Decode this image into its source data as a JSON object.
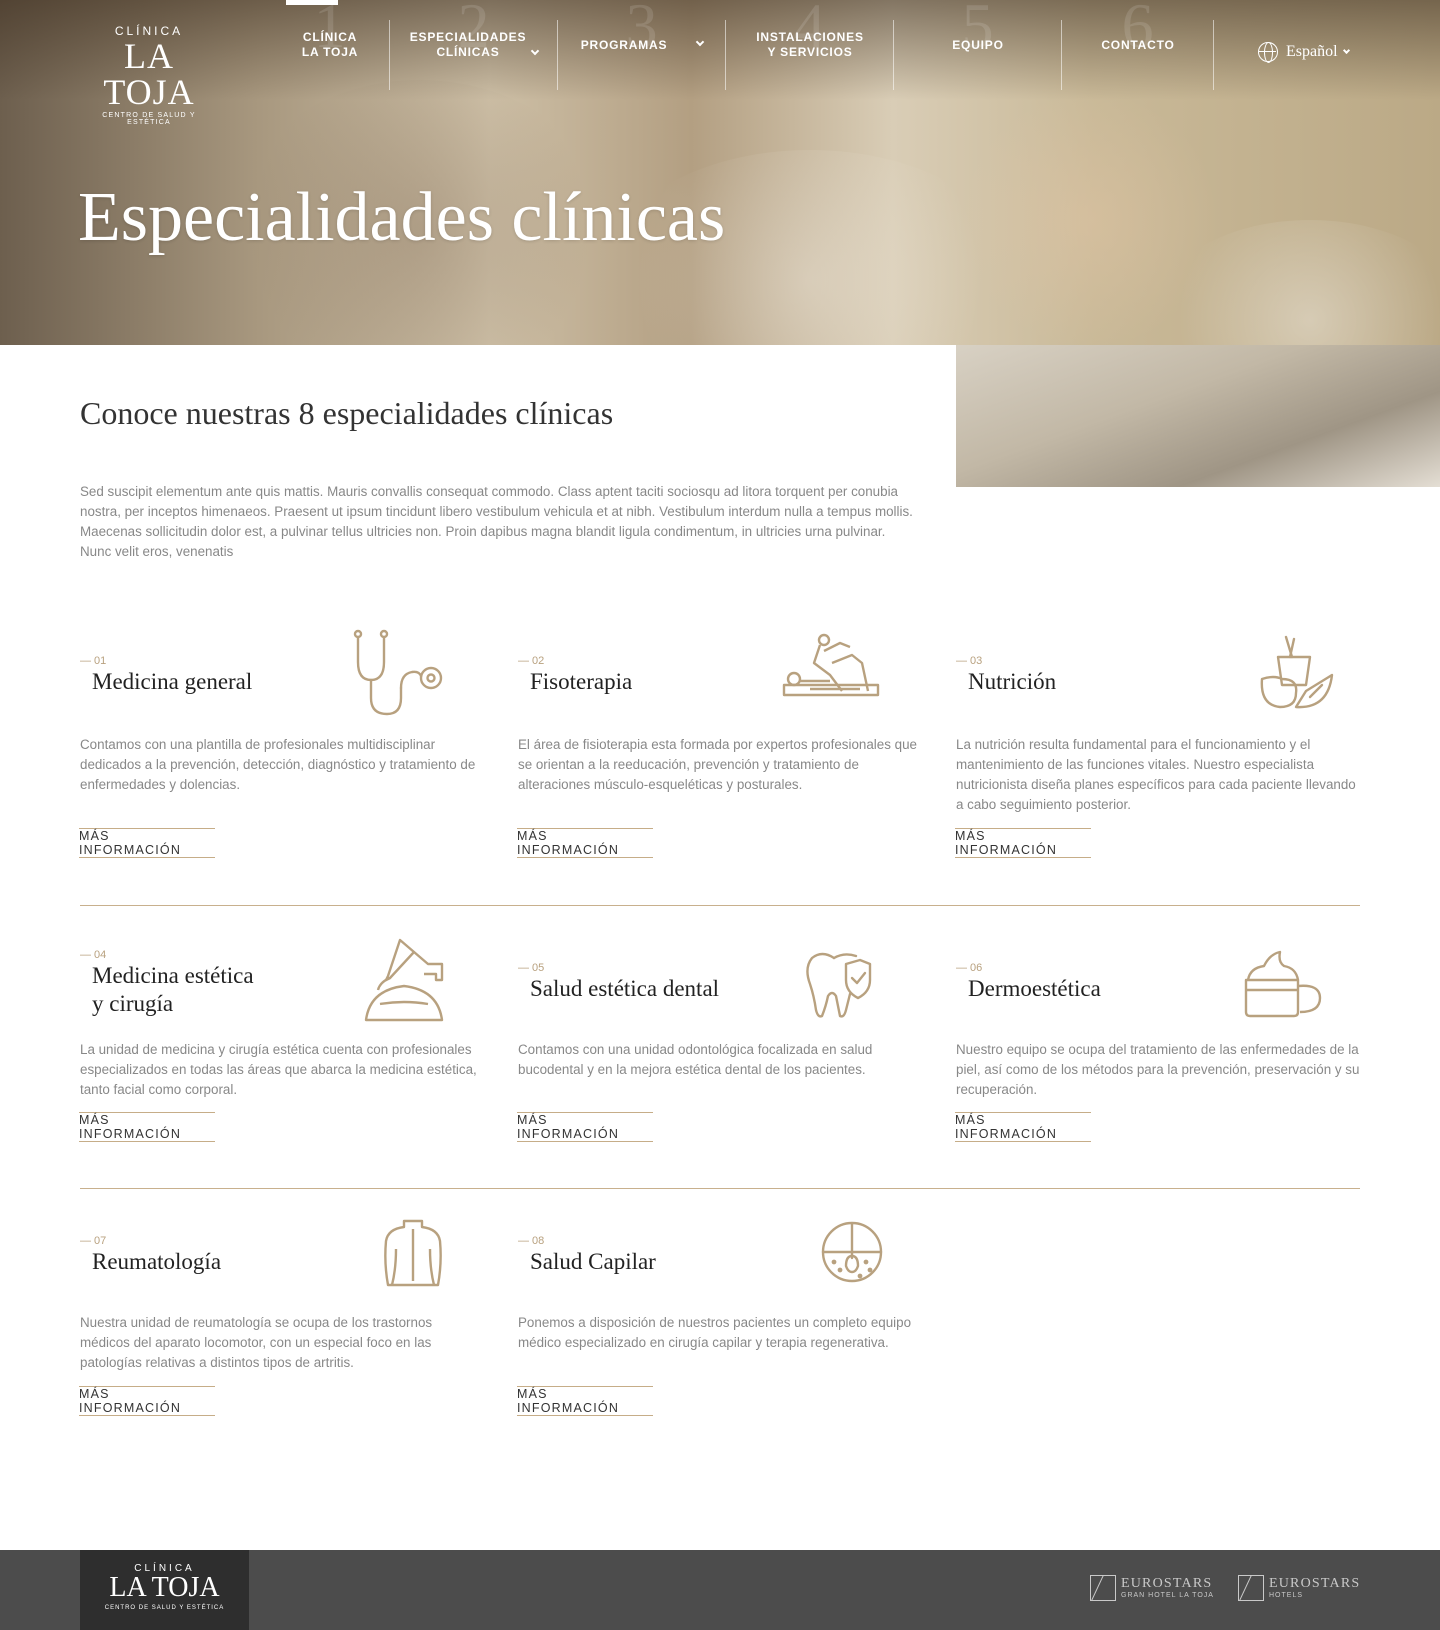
{
  "brand": {
    "logo_top": "CLÍNICA",
    "logo_main": "LA TOJA",
    "logo_sub": "CENTRO DE SALUD Y ESTÉTICA"
  },
  "nav": {
    "items": [
      {
        "label": "CLÍNICA\nLA TOJA",
        "number": "1",
        "active": true
      },
      {
        "label": "ESPECIALIDADES\nCLÍNICAS",
        "number": "2",
        "dropdown": true
      },
      {
        "label": "PROGRAMAS",
        "number": "3",
        "dropdown": true
      },
      {
        "label": "INSTALACIONES\nY SERVICIOS",
        "number": "4"
      },
      {
        "label": "EQUIPO",
        "number": "5"
      },
      {
        "label": "CONTACTO",
        "number": "6"
      }
    ],
    "language": "Español"
  },
  "hero": {
    "title": "Especialidades clínicas"
  },
  "intro": {
    "title": "Conoce nuestras 8 especialidades clínicas",
    "text": "Sed suscipit elementum ante quis mattis. Mauris convallis consequat commodo. Class aptent taciti sociosqu ad litora torquent per conubia nostra, per inceptos himenaeos. Praesent ut ipsum tincidunt libero vestibulum vehicula et at nibh. Vestibulum interdum nulla a tempus mollis. Maecenas sollicitudin dolor est, a pulvinar tellus ultricies non. Proin dapibus magna blandit ligula condimentum, in ultricies urna pulvinar. Nunc velit eros, venenatis"
  },
  "specialties": [
    {
      "number": "— 01",
      "title": "Medicina general",
      "icon": "stethoscope-icon",
      "description": "Contamos con una plantilla de profesionales multidisciplinar dedicados a la  prevención, detección, diagnóstico y tratamiento de enfermedades y dolencias.",
      "link": "MÁS INFORMACIÓN"
    },
    {
      "number": "— 02",
      "title": "Fisoterapia",
      "icon": "physiotherapy-icon",
      "description": "El área de fisioterapia esta formada por expertos profesionales que se orientan a la reeducación, prevención y tratamiento de alteraciones músculo-esqueléticas y posturales.",
      "link": "MÁS INFORMACIÓN"
    },
    {
      "number": "— 03",
      "title": "Nutrición",
      "icon": "nutrition-icon",
      "description": "La nutrición resulta fundamental para el funcionamiento y el mantenimiento de las funciones vitales. Nuestro especialista nutricionista diseña planes específicos para cada paciente llevando a cabo seguimiento posterior.",
      "link": "MÁS INFORMACIÓN"
    },
    {
      "number": "— 04",
      "title": "Medicina estética\ny cirugía",
      "icon": "aesthetic-surgery-icon",
      "description": "La unidad de medicina y cirugía estética cuenta con profesionales especializados en todas las áreas que abarca la medicina estética, tanto facial como corporal.",
      "link": "MÁS INFORMACIÓN"
    },
    {
      "number": "— 05",
      "title": "Salud estética dental",
      "icon": "tooth-shield-icon",
      "description": "Contamos con una unidad odontológica focalizada en salud bucodental y en la mejora estética dental de los pacientes.",
      "link": "MÁS INFORMACIÓN"
    },
    {
      "number": "— 06",
      "title": "Dermoestética",
      "icon": "cream-jar-icon",
      "description": "Nuestro equipo se ocupa del tratamiento de las enfermedades de la piel, así como de los métodos para la prevención, preservación y su recuperación.",
      "link": "MÁS INFORMACIÓN"
    },
    {
      "number": "— 07",
      "title": "Reumatología",
      "icon": "back-icon",
      "description": "Nuestra unidad de reumatología se ocupa de los trastornos médicos del aparato locomotor, con un especial foco en las patologías relativas a distintos tipos de artritis.",
      "link": "MÁS INFORMACIÓN"
    },
    {
      "number": "— 08",
      "title": "Salud Capilar",
      "icon": "hair-follicle-icon",
      "description": "Ponemos a disposición de nuestros pacientes un completo equipo médico especializado en  cirugía capilar y terapia regenerativa.",
      "link": "MÁS INFORMACIÓN"
    }
  ],
  "footer": {
    "logo_top": "CLÍNICA",
    "logo_main": "LA TOJA",
    "logo_sub": "CENTRO DE SALUD Y ESTÉTICA",
    "partners": [
      {
        "name": "EUROSTARS",
        "sub": "GRAN HOTEL LA TOJA"
      },
      {
        "name": "EUROSTARS",
        "sub": "HOTELS"
      }
    ]
  },
  "colors": {
    "accent": "#c6ad88",
    "footer_bg": "#4c4c4c",
    "footer_logo_bg": "#2e2e2e"
  }
}
